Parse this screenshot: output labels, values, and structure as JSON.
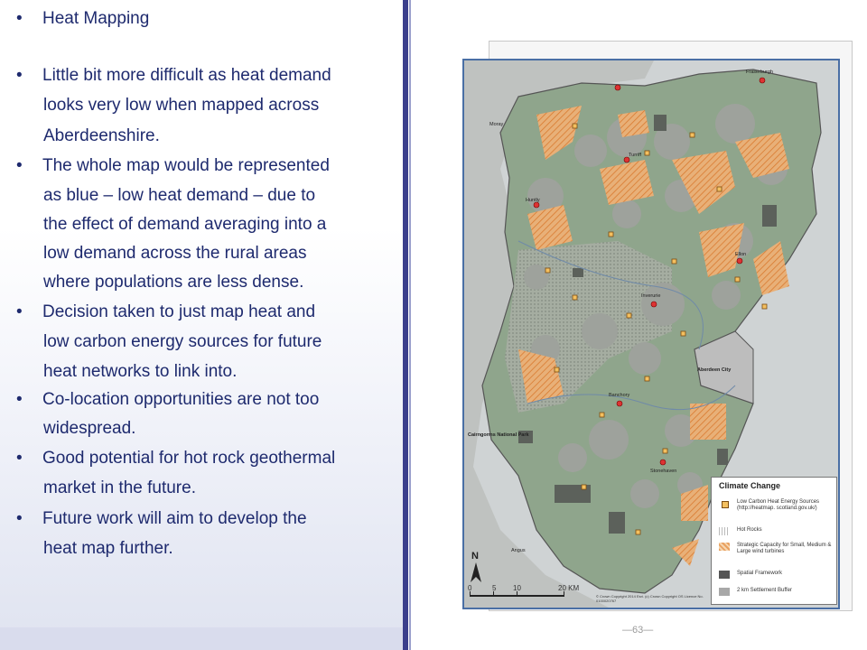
{
  "bullets": [
    {
      "lines": [
        "Heat Mapping"
      ]
    },
    {
      "lines": [
        "Little bit more difficult as heat demand",
        "looks very low when mapped across",
        "Aberdeenshire."
      ]
    },
    {
      "lines": [
        "The whole map would be represented",
        "as blue – low heat demand – due to",
        "the effect of demand averaging into a",
        "low demand across the rural areas",
        "where populations are less dense."
      ]
    },
    {
      "lines": [
        "Decision taken to just map heat and",
        "low carbon energy sources for future",
        "heat networks to link into."
      ]
    },
    {
      "lines": [
        "Co-location opportunities are not too",
        "widespread."
      ]
    },
    {
      "lines": [
        "Good potential for hot rock geothermal",
        "market in the future."
      ]
    },
    {
      "lines": [
        "Future work will aim to develop the",
        "heat map further."
      ]
    }
  ],
  "bullet_symbol": "•",
  "map": {
    "places": {
      "fraserburgh": "Fraserburgh",
      "moray": "Moray",
      "turriff": "Turriff",
      "huntly": "Huntly",
      "ellon": "Ellon",
      "inverurie": "Inverurie",
      "aberdeen_city": "Aberdeen City",
      "banchory": "Banchory",
      "cairngorms": "Cairngorms National Park",
      "stonehaven": "Stonehaven",
      "angus": "Angus"
    },
    "legend": {
      "title": "Climate Change",
      "items": [
        {
          "label": "Low Carbon Heat Energy Sources (http://heatmap. scotland.gov.uk/)",
          "color": "#e8a040"
        },
        {
          "label": "Hot Rocks",
          "color": "#bbbbbb"
        },
        {
          "label": "Strategic Capacity for Small, Medium & Large wind turbines",
          "color": "#e8a060"
        },
        {
          "label": "Spatial Framework",
          "color": "#555555"
        },
        {
          "label": "2 km Settlement Buffer",
          "color": "#a8a8a8"
        }
      ]
    },
    "north_label": "N",
    "scale_labels": [
      "0",
      "5",
      "10",
      "20 KM"
    ],
    "copyright": "© Crown Copyright 2014 Esri. (c) Crown Copyright OS Licence No. 0100020767"
  },
  "page_number": "—63—"
}
